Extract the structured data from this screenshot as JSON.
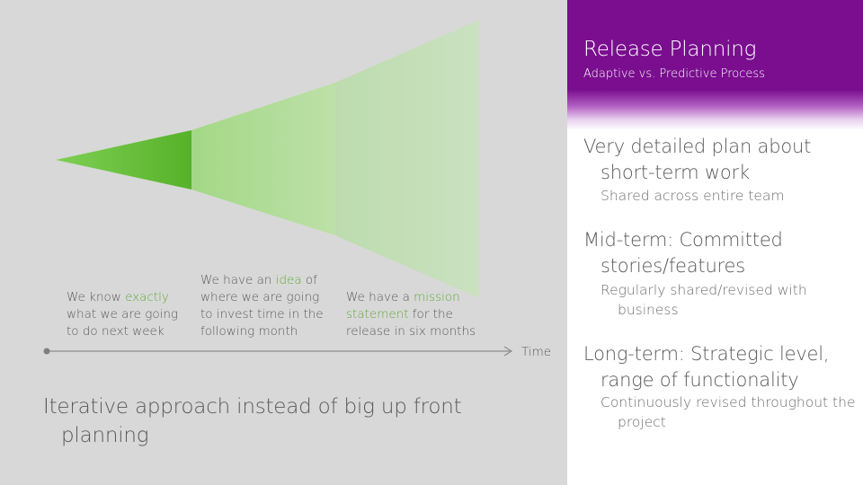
{
  "header": {
    "title": "Release Planning",
    "subtitle": "Adaptive vs. Predictive Process"
  },
  "bullets": [
    {
      "text": "Very detailed plan about short-term work",
      "sub": "Shared across entire team"
    },
    {
      "text": "Mid-term: Committed stories/features",
      "sub": "Regularly shared/revised with business"
    },
    {
      "text": "Long-term: Strategic level, range of functionality",
      "sub": "Continuously revised throughout the project"
    }
  ],
  "diagram": {
    "captions": [
      {
        "line1_pre": "We know ",
        "line1_hl": "exactly",
        "line2": "what we are going",
        "line3": "to do next week",
        "line4": ""
      },
      {
        "line1_pre": "We have an ",
        "line1_hl": "idea",
        "line1_post": " of",
        "line2": "where we are going",
        "line3": "to invest time in the",
        "line4": "following month"
      },
      {
        "line1_pre": "We have a ",
        "line1_hl": "mission",
        "line2_hl": "statement",
        "line2_post": " for the",
        "line3": "release in six months"
      }
    ],
    "axis_label": "Time"
  },
  "summary": "Iterative approach instead of big up front planning",
  "colors": {
    "accent_purple": "#7a0e8f",
    "green_dark": "#5cb82d",
    "green_mid": "#a6d98a",
    "green_light": "#c2dcb7",
    "highlight_green": "#60a83a"
  }
}
